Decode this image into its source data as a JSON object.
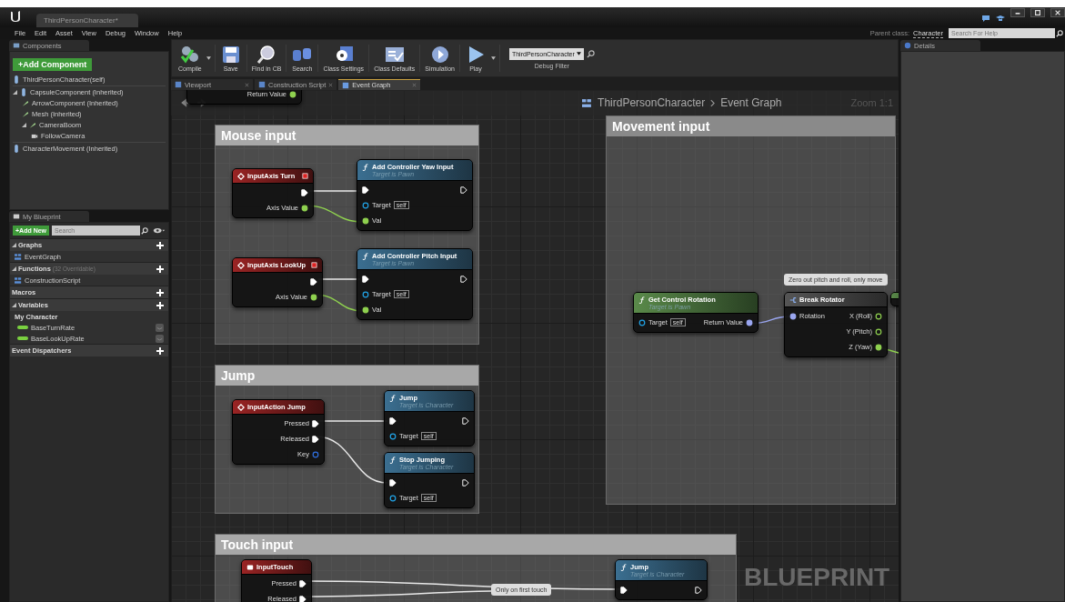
{
  "window": {
    "tab_title": "ThirdPersonCharacter*",
    "menu": [
      "File",
      "Edit",
      "Asset",
      "View",
      "Debug",
      "Window",
      "Help"
    ],
    "parent_class_label": "Parent class:",
    "parent_class": "Character",
    "help_search": {
      "placeholder": "Search For Help"
    }
  },
  "components": {
    "tab": "Components",
    "add_button": "+Add Component",
    "items": [
      {
        "label": "ThirdPersonCharacter(self)"
      },
      {
        "label": "CapsuleComponent (Inherited)",
        "expanded": true,
        "children": [
          {
            "label": "ArrowComponent (Inherited)"
          },
          {
            "label": "Mesh (Inherited)"
          },
          {
            "label": "CameraBoom",
            "expanded": true,
            "children": [
              {
                "label": "FollowCamera"
              }
            ]
          }
        ]
      },
      {
        "label": "CharacterMovement (Inherited)"
      }
    ]
  },
  "my_blueprint": {
    "tab": "My Blueprint",
    "add_button": "+Add New",
    "search": {
      "placeholder": "Search"
    },
    "sections": [
      {
        "title": "Graphs",
        "items": [
          {
            "label": "EventGraph"
          }
        ]
      },
      {
        "title": "Functions",
        "note": "(32 Overridable)",
        "items": [
          {
            "label": "ConstructionScript"
          }
        ]
      },
      {
        "title": "Macros"
      },
      {
        "title": "Variables",
        "items": [
          {
            "label": "My Character",
            "children": [
              {
                "label": "BaseTurnRate"
              },
              {
                "label": "BaseLookUpRate"
              }
            ]
          }
        ]
      },
      {
        "title": "Event Dispatchers"
      }
    ]
  },
  "toolbar": {
    "buttons": [
      {
        "label": "Compile",
        "dropdown": true
      },
      {
        "label": "Save",
        "dropdown": false
      },
      {
        "label": "Find in CB",
        "dropdown": false
      },
      {
        "label": "Search",
        "dropdown": false
      },
      {
        "label": "Class Settings",
        "dropdown": false
      },
      {
        "label": "Class Defaults",
        "dropdown": false
      },
      {
        "label": "Simulation",
        "dropdown": false
      },
      {
        "label": "Play",
        "dropdown": true
      }
    ],
    "debug_filter": {
      "value": "ThirdPersonCharacter",
      "label": "Debug Filter"
    }
  },
  "editor_tabs": [
    {
      "label": "Viewport",
      "selected": false
    },
    {
      "label": "Construction Script",
      "selected": false
    },
    {
      "label": "Event Graph",
      "selected": true
    }
  ],
  "graph": {
    "breadcrumb": [
      "ThirdPersonCharacter",
      "Event Graph"
    ],
    "zoom": "Zoom 1:1",
    "watermark": "BLUEPRINT",
    "comments": [
      {
        "title": "Mouse input"
      },
      {
        "title": "Jump"
      },
      {
        "title": "Touch input"
      },
      {
        "title": "Movement input"
      }
    ],
    "bubbles": [
      {
        "text": "Zero out pitch and roll, only move"
      },
      {
        "text": "Only on first touch"
      }
    ],
    "nodes": [
      {
        "kind": "partial",
        "outputs": [
          {
            "kind": "float",
            "label": "Return Value",
            "connected": true
          }
        ]
      },
      {
        "kind": "axis_event",
        "title": "InputAxis Turn",
        "outputs": [
          {
            "kind": "exec",
            "connected": true
          },
          {
            "kind": "float",
            "label": "Axis Value",
            "connected": true
          }
        ]
      },
      {
        "kind": "function",
        "title": "Add Controller Yaw Input",
        "subtitle": "Target is Pawn",
        "inputs": [
          {
            "kind": "exec",
            "connected": true
          },
          {
            "kind": "object",
            "label": "Target",
            "default": "self",
            "connected": false
          },
          {
            "kind": "float",
            "label": "Val",
            "connected": true
          }
        ],
        "outputs": [
          {
            "kind": "exec",
            "connected": false
          }
        ]
      },
      {
        "kind": "axis_event",
        "title": "InputAxis LookUp",
        "outputs": [
          {
            "kind": "exec",
            "connected": true
          },
          {
            "kind": "float",
            "label": "Axis Value",
            "connected": true
          }
        ]
      },
      {
        "kind": "function",
        "title": "Add Controller Pitch Input",
        "subtitle": "Target is Pawn",
        "inputs": [
          {
            "kind": "exec",
            "connected": true
          },
          {
            "kind": "object",
            "label": "Target",
            "default": "self",
            "connected": false
          },
          {
            "kind": "float",
            "label": "Val",
            "connected": true
          }
        ],
        "outputs": [
          {
            "kind": "exec",
            "connected": false
          }
        ]
      },
      {
        "kind": "action_event",
        "title": "InputAction Jump",
        "outputs": [
          {
            "kind": "exec",
            "label": "Pressed",
            "connected": true
          },
          {
            "kind": "exec",
            "label": "Released",
            "connected": true
          },
          {
            "kind": "key",
            "label": "Key",
            "connected": false
          }
        ]
      },
      {
        "kind": "function",
        "title": "Jump",
        "subtitle": "Target is Character",
        "inputs": [
          {
            "kind": "exec",
            "connected": true
          },
          {
            "kind": "object",
            "label": "Target",
            "default": "self",
            "connected": false
          }
        ],
        "outputs": [
          {
            "kind": "exec",
            "connected": false
          }
        ]
      },
      {
        "kind": "function",
        "title": "Stop Jumping",
        "subtitle": "Target is Character",
        "inputs": [
          {
            "kind": "exec",
            "connected": true
          },
          {
            "kind": "object",
            "label": "Target",
            "default": "self",
            "connected": false
          }
        ],
        "outputs": [
          {
            "kind": "exec",
            "connected": false
          }
        ]
      },
      {
        "kind": "pure",
        "title": "Get Control Rotation",
        "subtitle": "Target is Pawn",
        "inputs": [
          {
            "kind": "object",
            "label": "Target",
            "default": "self",
            "connected": false
          }
        ],
        "outputs": [
          {
            "kind": "struct",
            "label": "Return Value",
            "connected": true
          }
        ]
      },
      {
        "kind": "break",
        "title": "Break Rotator",
        "inputs": [
          {
            "kind": "struct",
            "label": "Rotation",
            "connected": true
          }
        ],
        "outputs": [
          {
            "kind": "float",
            "label": "X (Roll)",
            "connected": false
          },
          {
            "kind": "float",
            "label": "Y (Pitch)",
            "connected": false
          },
          {
            "kind": "float",
            "label": "Z (Yaw)",
            "connected": true
          }
        ]
      },
      {
        "kind": "stub"
      },
      {
        "kind": "touch_event",
        "title": "InputTouch",
        "outputs": [
          {
            "kind": "exec",
            "label": "Pressed",
            "connected": true
          },
          {
            "kind": "exec",
            "label": "Released",
            "connected": true
          }
        ]
      },
      {
        "kind": "function",
        "title": "Jump",
        "subtitle": "Target is Character",
        "inputs": [
          {
            "kind": "exec",
            "connected": true
          }
        ],
        "outputs": [
          {
            "kind": "exec",
            "connected": false
          }
        ]
      }
    ]
  },
  "details": {
    "tab": "Details"
  }
}
